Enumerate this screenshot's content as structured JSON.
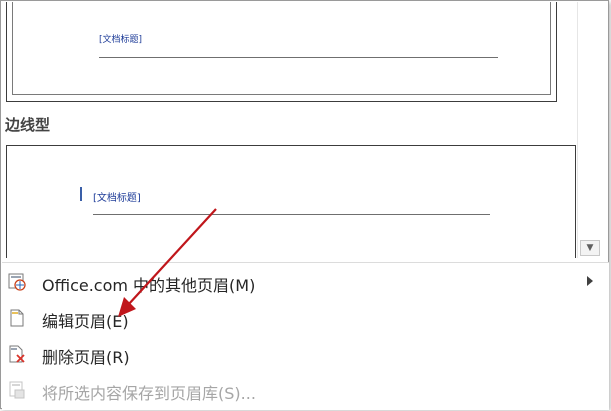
{
  "gallery": {
    "thumb1": {
      "doc_title": "[文档标题]"
    },
    "section_heading": "边线型",
    "thumb2": {
      "doc_title": "[文档标题]"
    },
    "scroll_down_glyph": "▼"
  },
  "menu": {
    "items": [
      {
        "label": "Office.com 中的其他页眉(M)",
        "icon": "office-globe-icon",
        "has_submenu": true,
        "enabled": true
      },
      {
        "label": "编辑页眉(E)",
        "icon": "page-edit-icon",
        "has_submenu": false,
        "enabled": true
      },
      {
        "label": "删除页眉(R)",
        "icon": "page-delete-icon",
        "has_submenu": false,
        "enabled": true
      },
      {
        "label": "将所选内容保存到页眉库(S)...",
        "icon": "save-to-gallery-icon",
        "has_submenu": false,
        "enabled": false
      }
    ]
  },
  "colors": {
    "annotation_arrow": "#c0161b",
    "title_blue": "#1f3d99",
    "delete_red": "#d9342b"
  }
}
